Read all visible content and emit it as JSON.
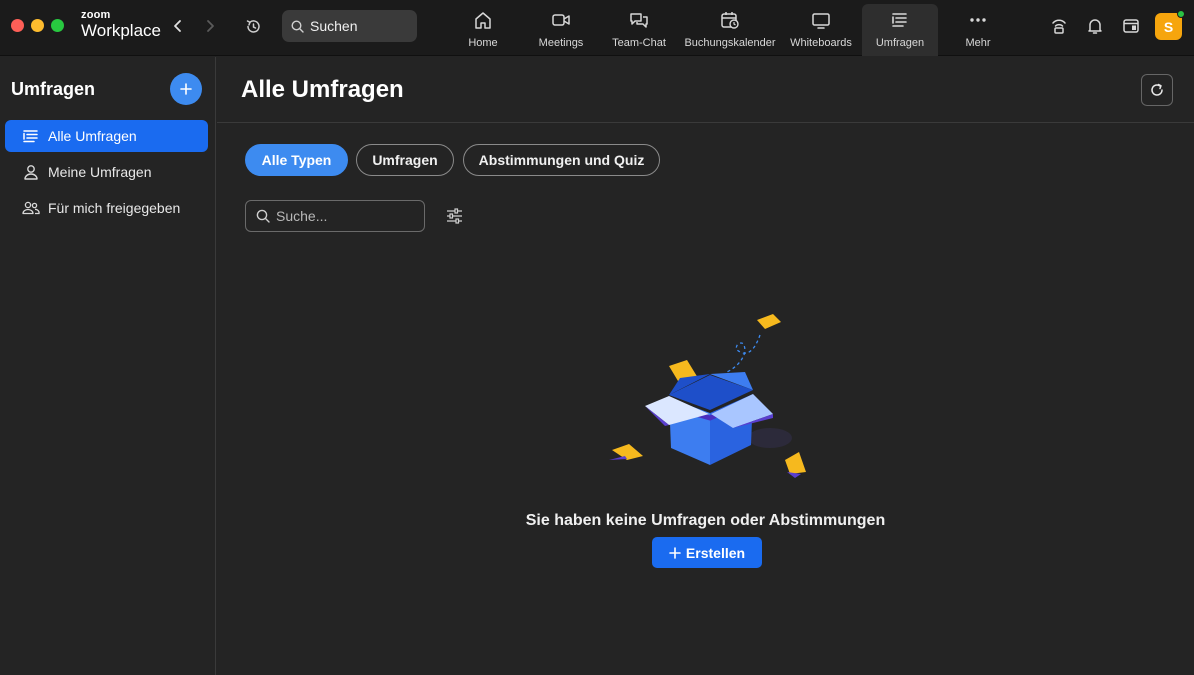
{
  "window": {
    "brand_small": "zoom",
    "brand_big": "Workplace"
  },
  "topbar": {
    "search_label": "Suchen",
    "tabs": [
      {
        "label": "Home",
        "icon": "home-icon"
      },
      {
        "label": "Meetings",
        "icon": "video-camera-icon"
      },
      {
        "label": "Team-Chat",
        "icon": "chat-bubbles-icon"
      },
      {
        "label": "Buchungskalender",
        "icon": "calendar-clock-icon"
      },
      {
        "label": "Whiteboards",
        "icon": "whiteboard-icon"
      },
      {
        "label": "Umfragen",
        "icon": "survey-list-icon"
      },
      {
        "label": "Mehr",
        "icon": "more-dots-icon"
      }
    ],
    "active_tab": "Umfragen",
    "avatar_initial": "S",
    "avatar_color": "#f6a50d",
    "presence_color": "#2bc244"
  },
  "sidebar": {
    "title": "Umfragen",
    "items": [
      {
        "label": "Alle Umfragen",
        "icon": "list-icon",
        "active": true
      },
      {
        "label": "Meine Umfragen",
        "icon": "person-icon",
        "active": false
      },
      {
        "label": "Für mich freigegeben",
        "icon": "people-icon",
        "active": false
      }
    ]
  },
  "main": {
    "title": "Alle Umfragen",
    "filters": [
      {
        "label": "Alle Typen",
        "active": true
      },
      {
        "label": "Umfragen",
        "active": false
      },
      {
        "label": "Abstimmungen und Quiz",
        "active": false
      }
    ],
    "search_placeholder": "Suche...",
    "empty_message": "Sie haben keine Umfragen oder Abstimmungen",
    "create_label": "Erstellen"
  },
  "colors": {
    "accent": "#1a6bf0",
    "accent_light": "#3d8bf0",
    "background": "#242424",
    "topbar": "#1b1b1b"
  }
}
